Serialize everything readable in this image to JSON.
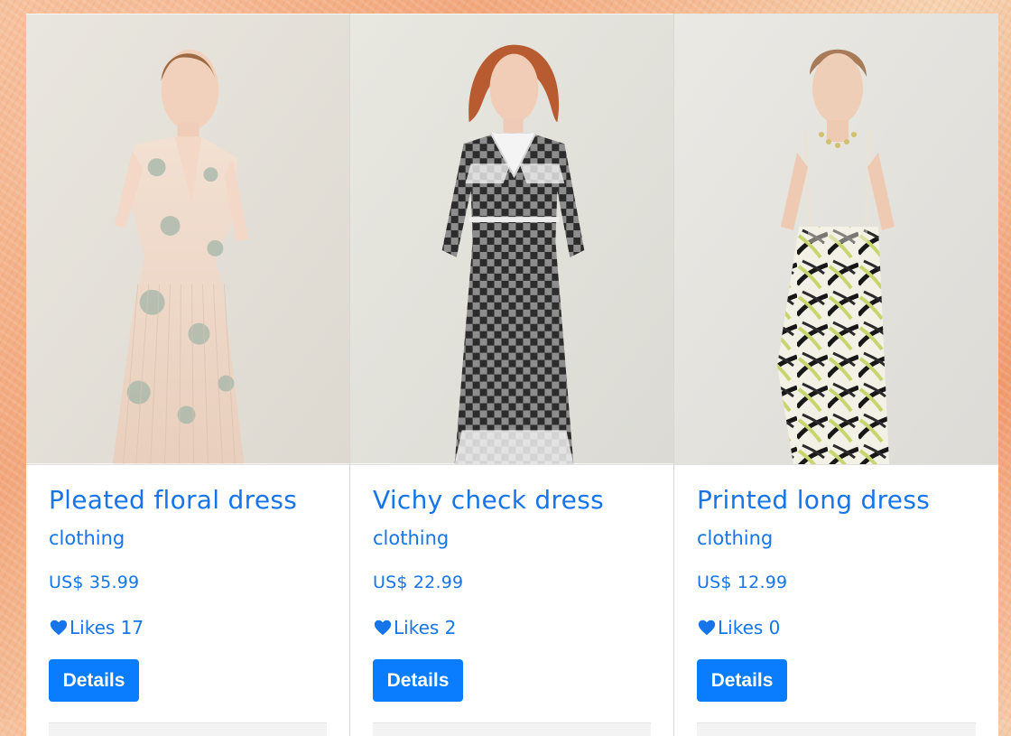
{
  "products": [
    {
      "title": "Pleated floral dress",
      "category": "clothing",
      "price": "US$ 35.99",
      "likes_text": "Likes 17",
      "button_label": "Details",
      "image_icon": "dress-photo-icon"
    },
    {
      "title": "Vichy check dress",
      "category": "clothing",
      "price": "US$ 22.99",
      "likes_text": "Likes 2",
      "button_label": "Details",
      "image_icon": "dress-photo-icon"
    },
    {
      "title": "Printed long dress",
      "category": "clothing",
      "price": "US$ 12.99",
      "likes_text": "Likes 0",
      "button_label": "Details",
      "image_icon": "dress-photo-icon"
    }
  ],
  "colors": {
    "accent": "#1675ea",
    "button": "#0a7dff"
  }
}
